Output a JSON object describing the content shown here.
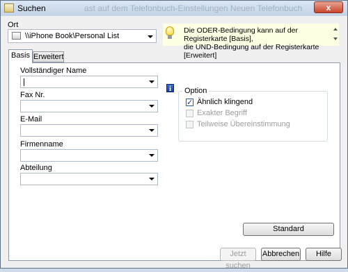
{
  "window": {
    "title": "Suchen",
    "background_title_ghost": "ast auf dem Telefonbuch-Einstellungen Neuen Telefonbuch",
    "close_glyph": "x"
  },
  "location": {
    "label": "Ort",
    "value": "\\\\iPhone Book\\Personal List"
  },
  "info": {
    "line1": "Die ODER-Bedingung kann auf der Registerkarte [Basis],",
    "line2": "die UND-Bedingung auf der Registerkarte [Erweitert]"
  },
  "tabs": [
    {
      "label": "Basis",
      "active": true
    },
    {
      "label": "Erweitert",
      "active": false
    }
  ],
  "fields": [
    {
      "label": "Vollständiger Name",
      "value": ""
    },
    {
      "label": "Fax Nr.",
      "value": ""
    },
    {
      "label": "E-Mail",
      "value": ""
    },
    {
      "label": "Firmenname",
      "value": ""
    },
    {
      "label": "Abteilung",
      "value": ""
    }
  ],
  "option": {
    "title": "Option",
    "info_glyph": "i",
    "items": [
      {
        "label": "Ähnlich klingend",
        "checked": true,
        "enabled": true
      },
      {
        "label": "Exakter Begriff",
        "checked": false,
        "enabled": false
      },
      {
        "label": "Teilweise Übereinstimmung",
        "checked": false,
        "enabled": false
      }
    ]
  },
  "buttons": {
    "standard": "Standard",
    "search": "Jetzt suchen",
    "cancel": "Abbrechen",
    "help": "Hilfe"
  },
  "icons": {
    "app": "search-dialog-icon",
    "location": "folder-icon",
    "hint": "lightbulb-icon",
    "option_info": "info-icon"
  }
}
